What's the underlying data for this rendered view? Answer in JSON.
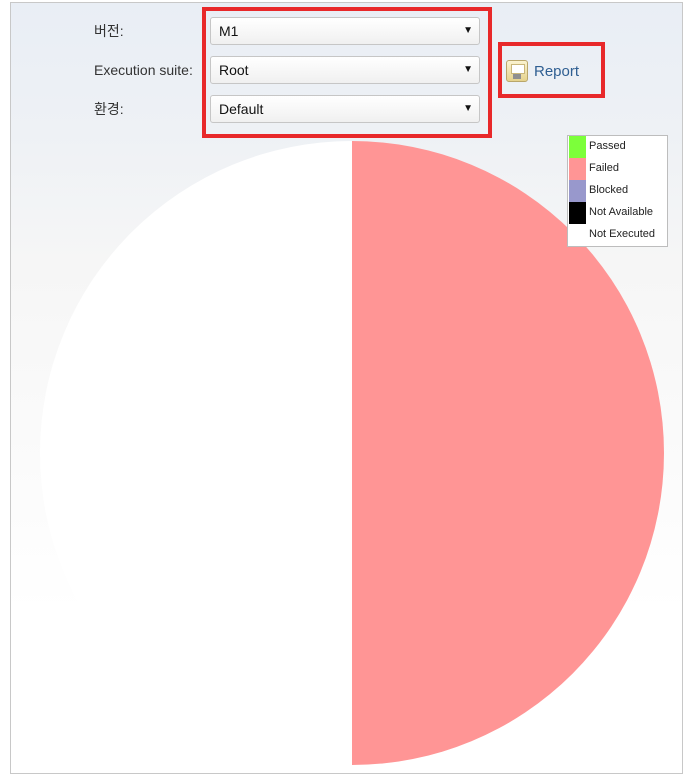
{
  "form": {
    "version_label": "버전:",
    "version_value": "M1",
    "suite_label": "Execution suite:",
    "suite_value": "Root",
    "environment_label": "환경:",
    "environment_value": "Default"
  },
  "report": {
    "label": "Report",
    "icon": "save-disk-icon"
  },
  "colors": {
    "highlight": "#e8282a"
  },
  "chart_data": {
    "type": "pie",
    "categories": [
      "Passed",
      "Failed",
      "Blocked",
      "Not Available",
      "Not Executed"
    ],
    "values": [
      0,
      50,
      0,
      0,
      50
    ],
    "colors": [
      "#7cff3a",
      "#ff9595",
      "#9898cc",
      "#000000",
      "#ffffff"
    ],
    "legend_placement": "top-right"
  }
}
